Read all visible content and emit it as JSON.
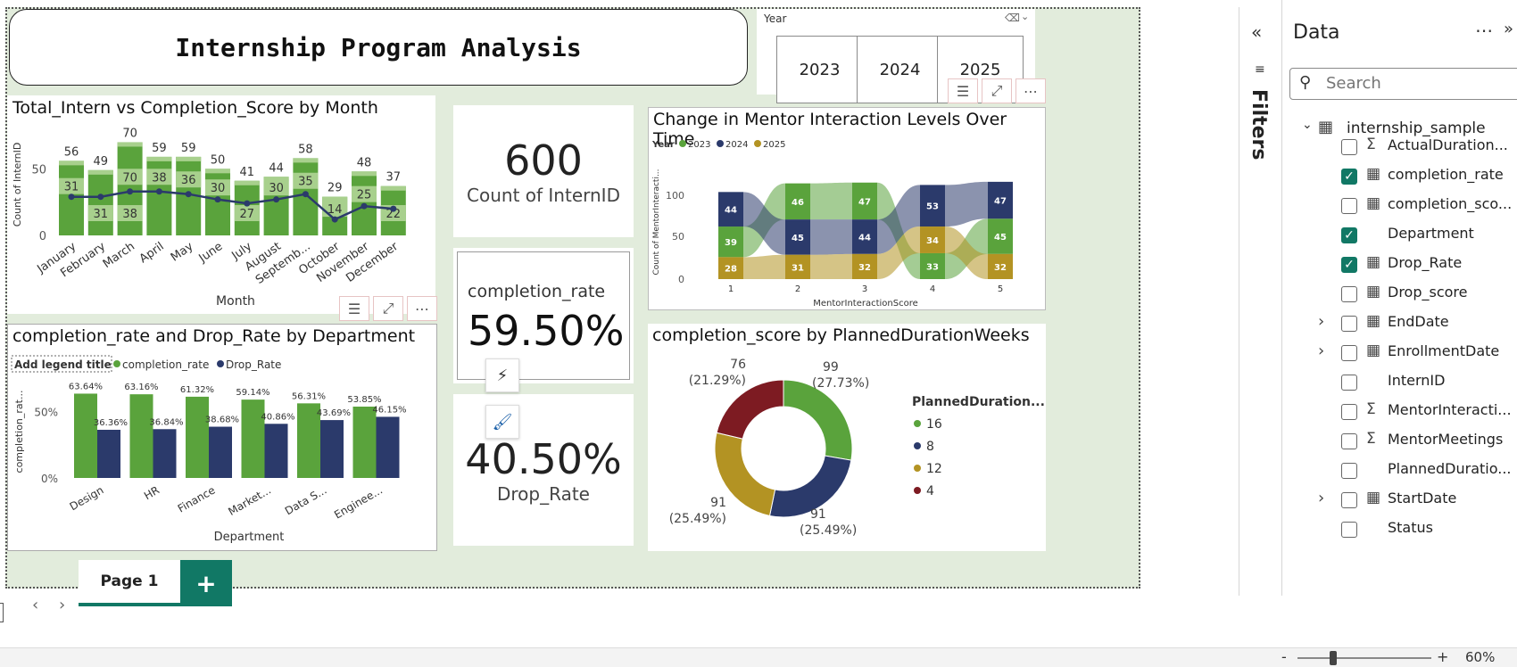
{
  "header": {
    "title": "Internship Program Analysis"
  },
  "slicer": {
    "label": "Year",
    "years": [
      "2023",
      "2024",
      "2025"
    ]
  },
  "bar_line_chart": {
    "title": "Total_Intern vs Completion_Score by Month",
    "xlabel": "Month",
    "ylabel": "Count of InternID",
    "y_ticks": [
      "50",
      "0"
    ]
  },
  "kpi": {
    "count_value": "600",
    "count_label": "Count of InternID",
    "completion_label": "completion_rate",
    "completion_value": "59.50%",
    "drop_value": "40.50%",
    "drop_label": "Drop_Rate"
  },
  "ribbon_chart": {
    "title": "Change in Mentor Interaction Levels Over Time",
    "legend_title": "Year",
    "xlabel": "MentorInteractionScore",
    "ylabel": "Count of MentorInteracti...",
    "y_ticks": [
      "100",
      "50",
      "0"
    ]
  },
  "dept_chart": {
    "title": "completion_rate and Drop_Rate by Department",
    "legend_placeholder": "Add legend title",
    "xlabel": "Department",
    "ylabel": "completion_rat...",
    "y_ticks": [
      "50%",
      "0%"
    ]
  },
  "donut_chart": {
    "title": "completion_score by PlannedDurationWeeks",
    "legend_title": "PlannedDuration...",
    "slice_labels": [
      {
        "count": "99",
        "pct": "(27.73%)"
      },
      {
        "count": "91",
        "pct": "(25.49%)"
      },
      {
        "count": "91",
        "pct": "(25.49%)"
      },
      {
        "count": "76",
        "pct": "(21.29%)"
      }
    ]
  },
  "chart_data": [
    {
      "type": "bar",
      "title": "Total_Intern vs Completion_Score by Month",
      "xlabel": "Month",
      "ylabel": "Count of InternID",
      "categories": [
        "January",
        "February",
        "March",
        "April",
        "May",
        "June",
        "July",
        "August",
        "Septemb...",
        "October",
        "November",
        "December"
      ],
      "series": [
        {
          "values": [
            56,
            49,
            70,
            59,
            59,
            50,
            41,
            44,
            58,
            29,
            48,
            37
          ],
          "kind": "stacked-total"
        },
        {
          "values": [
            31,
            31,
            38,
            38,
            36,
            30,
            27,
            30,
            35,
            14,
            25,
            22
          ],
          "kind": "segment-label"
        },
        {
          "values": [
            29,
            29,
            33,
            33,
            31,
            27,
            24,
            27,
            31,
            12,
            22,
            20
          ],
          "kind": "line",
          "color": "#2b3a6b"
        }
      ],
      "segment_labels_bottom": [
        "",
        "31",
        "38",
        "",
        "",
        "",
        "27",
        "",
        "",
        "",
        "",
        "22"
      ],
      "segment_labels_top": [
        "31",
        "",
        "70",
        "38",
        "36",
        "30",
        "",
        "30",
        "35",
        "14",
        "25",
        ""
      ],
      "ylim": [
        0,
        75
      ]
    },
    {
      "type": "area",
      "subtype": "ribbon",
      "title": "Change in Mentor Interaction Levels Over Time",
      "xlabel": "MentorInteractionScore",
      "categories": [
        "1",
        "2",
        "3",
        "4",
        "5"
      ],
      "series": [
        {
          "name": "2023",
          "values": [
            39,
            46,
            47,
            33,
            45
          ],
          "color": "#5aa33c"
        },
        {
          "name": "2024",
          "values": [
            44,
            45,
            44,
            53,
            47
          ],
          "color": "#2b3a6b"
        },
        {
          "name": "2025",
          "values": [
            28,
            31,
            32,
            34,
            32
          ],
          "color": "#b39323"
        }
      ],
      "order_bottom_to_top": [
        [
          "2025",
          "2023",
          "2024"
        ],
        [
          "2025",
          "2024",
          "2023"
        ],
        [
          "2025",
          "2024",
          "2023"
        ],
        [
          "2023",
          "2025",
          "2024"
        ],
        [
          "2025",
          "2023",
          "2024"
        ]
      ],
      "ylim": [
        0,
        125
      ]
    },
    {
      "type": "bar",
      "title": "completion_rate and Drop_Rate by Department",
      "xlabel": "Department",
      "categories": [
        "Design",
        "HR",
        "Finance",
        "Market...",
        "Data S...",
        "Enginee..."
      ],
      "series": [
        {
          "name": "completion_rate",
          "values": [
            63.64,
            63.16,
            61.32,
            59.14,
            56.31,
            53.85
          ],
          "labels": [
            "63.64%",
            "63.16%",
            "61.32%",
            "59.14%",
            "56.31%",
            "53.85%"
          ],
          "color": "#5aa33c"
        },
        {
          "name": "Drop_Rate",
          "values": [
            36.36,
            36.84,
            38.68,
            40.86,
            43.69,
            46.15
          ],
          "labels": [
            "36.36%",
            "36.84%",
            "38.68%",
            "40.86%",
            "43.69%",
            "46.15%"
          ],
          "color": "#2b3a6b"
        }
      ],
      "ylim": [
        0,
        70
      ]
    },
    {
      "type": "pie",
      "subtype": "donut",
      "title": "completion_score by PlannedDurationWeeks",
      "categories": [
        "16",
        "8",
        "12",
        "4"
      ],
      "values": [
        99,
        91,
        91,
        76
      ],
      "colors": [
        "#5aa33c",
        "#2b3a6b",
        "#b39323",
        "#7d1b22"
      ]
    }
  ],
  "colors": {
    "green": "#5aa33c",
    "light_green": "#a8d08d",
    "navy": "#2b3a6b",
    "gold": "#b39323",
    "maroon": "#7d1b22",
    "accent": "#117865"
  },
  "filters_pane": {
    "label": "Filters"
  },
  "data_pane": {
    "title": "Data",
    "search_placeholder": "Search",
    "table": "internship_sample",
    "fields": [
      {
        "label": "ActualDuration...",
        "icon": "sigma-icon",
        "checked": false,
        "expandable": false
      },
      {
        "label": "completion_rate",
        "icon": "calc-icon",
        "checked": true,
        "expandable": false
      },
      {
        "label": "completion_sco...",
        "icon": "calc-icon",
        "checked": false,
        "expandable": false
      },
      {
        "label": "Department",
        "icon": "",
        "checked": true,
        "expandable": false
      },
      {
        "label": "Drop_Rate",
        "icon": "calc-icon",
        "checked": true,
        "expandable": false
      },
      {
        "label": "Drop_score",
        "icon": "calc-icon",
        "checked": false,
        "expandable": false
      },
      {
        "label": "EndDate",
        "icon": "calendar-icon",
        "checked": false,
        "expandable": true
      },
      {
        "label": "EnrollmentDate",
        "icon": "calendar-icon",
        "checked": false,
        "expandable": true
      },
      {
        "label": "InternID",
        "icon": "",
        "checked": false,
        "expandable": false
      },
      {
        "label": "MentorInteracti...",
        "icon": "sigma-icon",
        "checked": false,
        "expandable": false
      },
      {
        "label": "MentorMeetings",
        "icon": "sigma-icon",
        "checked": false,
        "expandable": false
      },
      {
        "label": "PlannedDuratio...",
        "icon": "",
        "checked": false,
        "expandable": false
      },
      {
        "label": "StartDate",
        "icon": "calendar-icon",
        "checked": false,
        "expandable": true
      },
      {
        "label": "Status",
        "icon": "",
        "checked": false,
        "expandable": false
      }
    ]
  },
  "pages": {
    "tabs": [
      "Page 1"
    ],
    "add_label": "+"
  },
  "zoom": {
    "value": "60%",
    "minus": "-",
    "plus": "+"
  }
}
